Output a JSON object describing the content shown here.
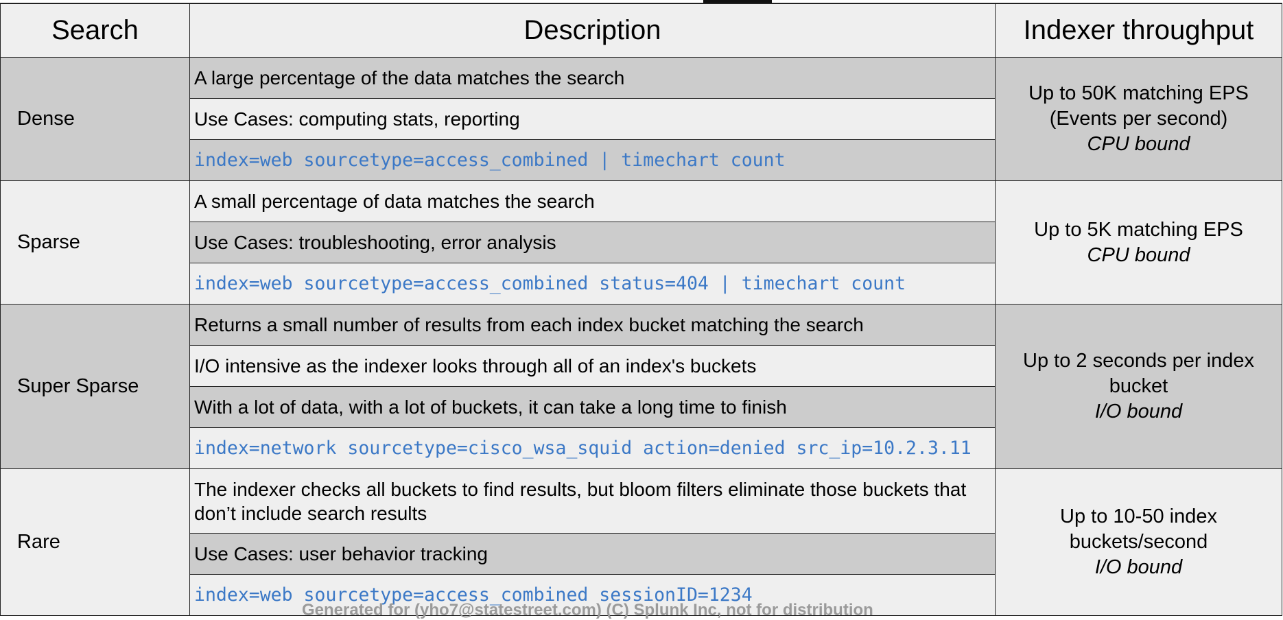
{
  "headers": {
    "search": "Search",
    "description": "Description",
    "throughput": "Indexer throughput"
  },
  "groups": [
    {
      "name": "Dense",
      "rows": [
        {
          "text": "A large percentage of the data matches the search",
          "code": false
        },
        {
          "text": "Use Cases: computing stats, reporting",
          "code": false
        },
        {
          "text": "index=web sourcetype=access_combined | timechart count",
          "code": true
        }
      ],
      "throughput": {
        "lines": [
          "Up to 50K matching EPS",
          "(Events per second)"
        ],
        "bound": "CPU bound"
      }
    },
    {
      "name": "Sparse",
      "rows": [
        {
          "text": "A small percentage of data matches the search",
          "code": false
        },
        {
          "text": "Use Cases: troubleshooting, error analysis",
          "code": false
        },
        {
          "text": "index=web sourcetype=access_combined status=404 | timechart count",
          "code": true
        }
      ],
      "throughput": {
        "lines": [
          "Up to 5K matching EPS"
        ],
        "bound": "CPU bound"
      }
    },
    {
      "name": "Super Sparse",
      "rows": [
        {
          "text": "Returns a small number of results from each index bucket matching the search",
          "code": false
        },
        {
          "text": "I/O intensive as the indexer looks through all of an index's buckets",
          "code": false
        },
        {
          "text": "With a lot of data, with a lot of buckets, it can take a long time to finish",
          "code": false
        },
        {
          "text": "index=network sourcetype=cisco_wsa_squid action=denied src_ip=10.2.3.11",
          "code": true
        }
      ],
      "throughput": {
        "lines": [
          "Up to 2 seconds per index bucket"
        ],
        "bound": "I/O bound"
      }
    },
    {
      "name": "Rare",
      "rows": [
        {
          "text": "The indexer checks all buckets to find results, but bloom filters eliminate those buckets that don’t include search results",
          "code": false
        },
        {
          "text": "Use Cases: user behavior tracking",
          "code": false
        },
        {
          "text": "index=web sourcetype=access_combined sessionID=1234",
          "code": true
        }
      ],
      "throughput": {
        "lines": [
          "Up to 10-50 index buckets/second"
        ],
        "bound": "I/O bound"
      }
    }
  ],
  "watermark": "Generated for (yho7@statestreet.com) (C) Splunk Inc, not for distribution"
}
